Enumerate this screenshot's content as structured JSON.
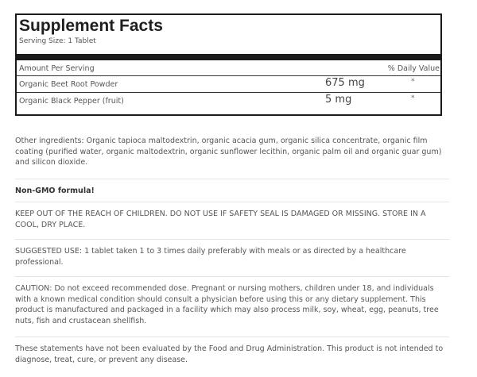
{
  "supplement_facts": {
    "title": "Supplement Facts",
    "serving_size": "Serving Size: 1 Tablet",
    "header": {
      "amount_label": "Amount Per Serving",
      "dv_label": "% Daily Value"
    },
    "rows": [
      {
        "name": "Organic Beet Root Powder",
        "amount": "675 mg",
        "dv": "*"
      },
      {
        "name": "Organic Black Pepper (fruit)",
        "amount": "5 mg",
        "dv": "*"
      }
    ]
  },
  "sections": {
    "other_ingredients": "Other ingredients: Organic tapioca maltodextrin, organic acacia gum, organic silica concentrate, organic film coating (purified water, organic maltodextrin, organic sunflower lecithin, organic palm oil and organic guar gum) and silicon dioxide.",
    "non_gmo": "Non-GMO formula!",
    "storage": "KEEP OUT OF THE REACH OF CHILDREN. DO NOT USE IF SAFETY SEAL IS DAMAGED OR MISSING. STORE IN A COOL, DRY PLACE.",
    "suggested_use": "SUGGESTED USE: 1 tablet taken 1 to 3 times daily preferably with meals or as directed by a healthcare professional.",
    "caution": "CAUTION: Do not exceed recommended dose. Pregnant or nursing mothers, children under 18, and individuals with a known medical condition should consult a physician before using this or any dietary supplement. This product is manufactured and packaged in a facility which may also process milk, soy, wheat, egg, peanuts, tree nuts, fish and crustacean shellfish.",
    "fda_disclaimer": "These statements have not been evaluated by the Food and Drug Administration. This product is not intended to diagnose, treat, cure, or prevent any disease."
  }
}
